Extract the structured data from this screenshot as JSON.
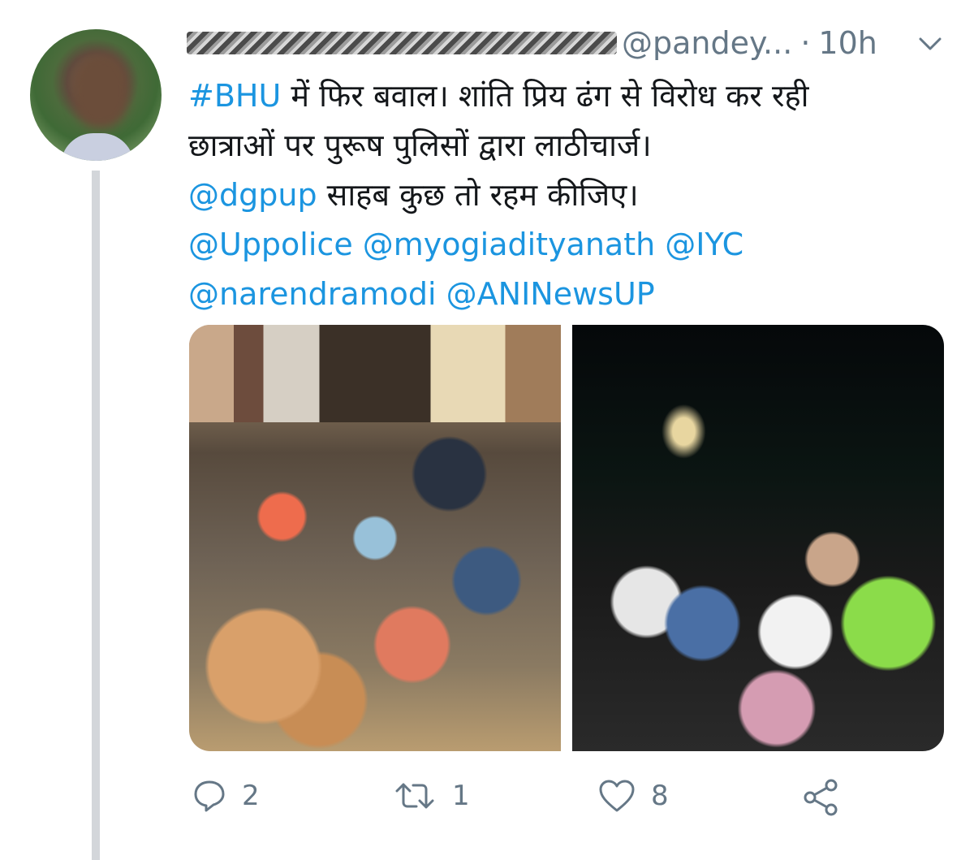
{
  "tweet": {
    "handle": "@pandey...",
    "separator": "·",
    "time": "10h",
    "text_lines": [
      {
        "parts": [
          {
            "text": "#BHU",
            "link": true
          },
          {
            "text": " में फिर बवाल। शांति प्रिय ढंग से विरोध  कर रही",
            "link": false
          }
        ]
      },
      {
        "parts": [
          {
            "text": "छात्राओं पर पुरूष पुलिसों द्वारा लाठीचार्ज।",
            "link": false
          }
        ]
      },
      {
        "parts": [
          {
            "text": "@dgpup",
            "link": true
          },
          {
            "text": "  साहब कुछ तो रहम कीजिए।",
            "link": false
          }
        ]
      },
      {
        "parts": [
          {
            "text": "@Uppolice @myogiadityanath @IYC",
            "link": true
          }
        ]
      },
      {
        "parts": [
          {
            "text": "@narendramodi @ANINewsUP",
            "link": true
          }
        ]
      }
    ],
    "actions": {
      "reply_count": "2",
      "retweet_count": "1",
      "like_count": "8"
    }
  },
  "colors": {
    "text": "#14171a",
    "link": "#1b95e0",
    "secondary": "#657786",
    "thread_line": "#d3d6da"
  },
  "icons": [
    "chevron-down-icon",
    "reply-icon",
    "retweet-icon",
    "like-icon",
    "share-icon"
  ]
}
